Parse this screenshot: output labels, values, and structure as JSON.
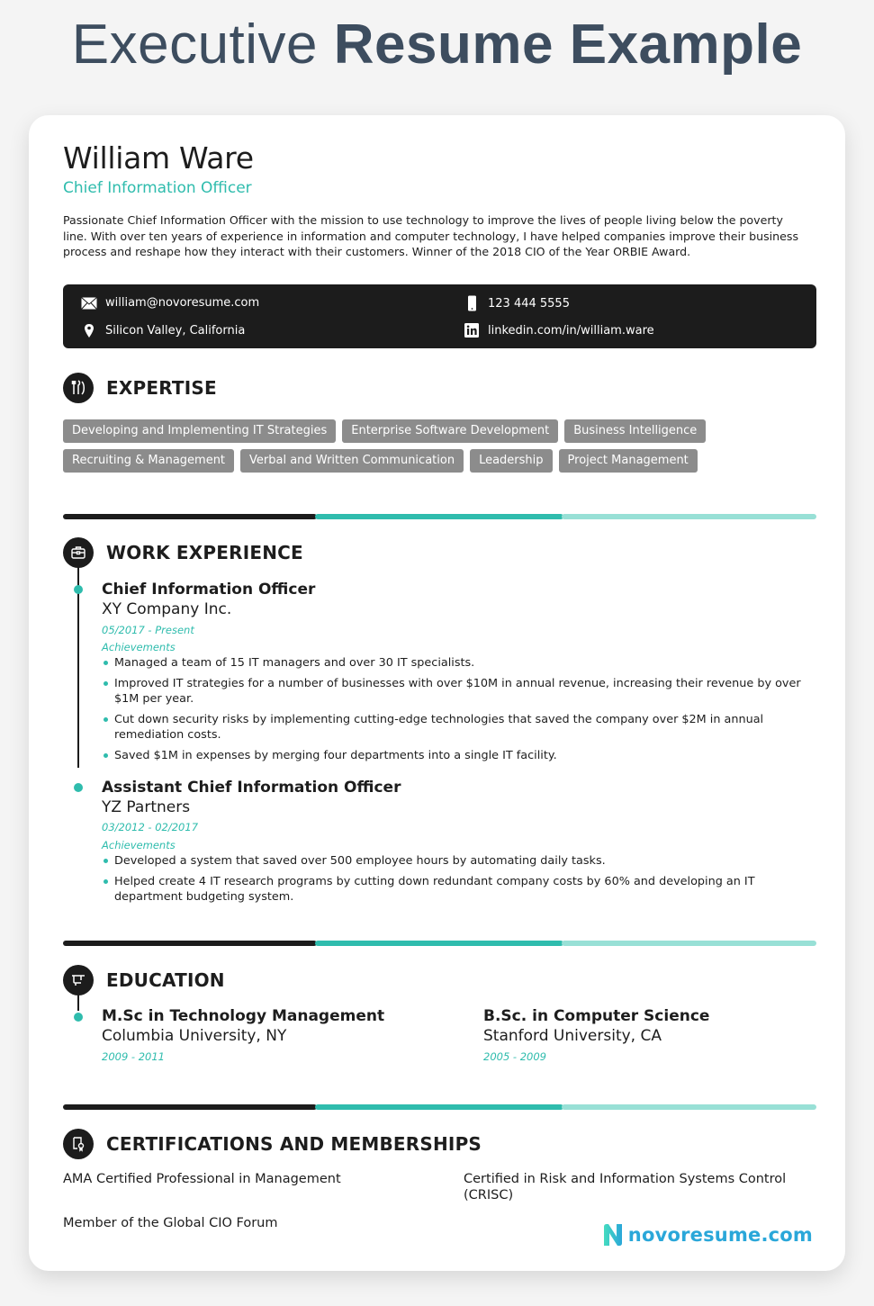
{
  "page_heading": {
    "light": "Executive",
    "bold": "Resume Example"
  },
  "resume": {
    "name": "William Ware",
    "role": "Chief Information Officer",
    "summary": "Passionate Chief Information Officer with the mission to use technology to improve the lives of people living below the poverty line. With over ten years of experience in information and computer technology, I have helped companies improve their business process and reshape how they interact with their customers. Winner of the 2018 CIO of the Year ORBIE Award.",
    "contact": {
      "email": "william@novoresume.com",
      "phone": "123 444 5555",
      "location": "Silicon Valley, California",
      "linkedin": "linkedin.com/in/william.ware"
    },
    "expertise": {
      "title": "EXPERTISE",
      "rows": [
        [
          "Developing and Implementing IT Strategies",
          "Enterprise Software Development",
          "Business Intelligence"
        ],
        [
          "Recruiting & Management",
          "Verbal and Written Communication",
          "Leadership",
          "Project Management"
        ]
      ]
    },
    "work": {
      "title": "WORK EXPERIENCE",
      "jobs": [
        {
          "title": "Chief Information Officer",
          "company": "XY Company Inc.",
          "dates": "05/2017 - Present",
          "achievements_label": "Achievements",
          "bullets": [
            "Managed a team of 15 IT managers and over 30 IT specialists.",
            "Improved IT strategies for a number of businesses with over $10M in annual revenue, increasing their revenue by over $1M per year.",
            "Cut down security risks by implementing cutting-edge technologies that saved the company over $2M in annual remediation costs.",
            "Saved $1M in expenses by merging four departments into a single IT facility."
          ]
        },
        {
          "title": "Assistant Chief Information Officer",
          "company": "YZ Partners",
          "dates": "03/2012 - 02/2017",
          "achievements_label": "Achievements",
          "bullets": [
            "Developed a system that saved over 500 employee hours by automating daily tasks.",
            "Helped create 4 IT research programs by cutting down redundant company costs by 60% and developing an IT department budgeting system."
          ]
        }
      ]
    },
    "education": {
      "title": "EDUCATION",
      "items": [
        {
          "degree": "M.Sc in Technology Management",
          "school": "Columbia University, NY",
          "dates": "2009 - 2011"
        },
        {
          "degree": "B.Sc. in Computer Science",
          "school": "Stanford University, CA",
          "dates": "2005 - 2009"
        }
      ]
    },
    "certifications": {
      "title": "CERTIFICATIONS AND MEMBERSHIPS",
      "items": [
        "AMA Certified Professional in Management",
        "Certified in Risk and Information Systems Control (CRISC)",
        "Member of the Global CIO Forum"
      ]
    }
  },
  "brand": {
    "logo_text": "novoresume.com"
  },
  "colors": {
    "accent": "#2fbcad",
    "accent_light": "#98e0d6",
    "dark": "#1c1c1c",
    "tag": "#8c8c8c",
    "heading": "#3d4d5f",
    "logo": "#2aa7d9"
  }
}
